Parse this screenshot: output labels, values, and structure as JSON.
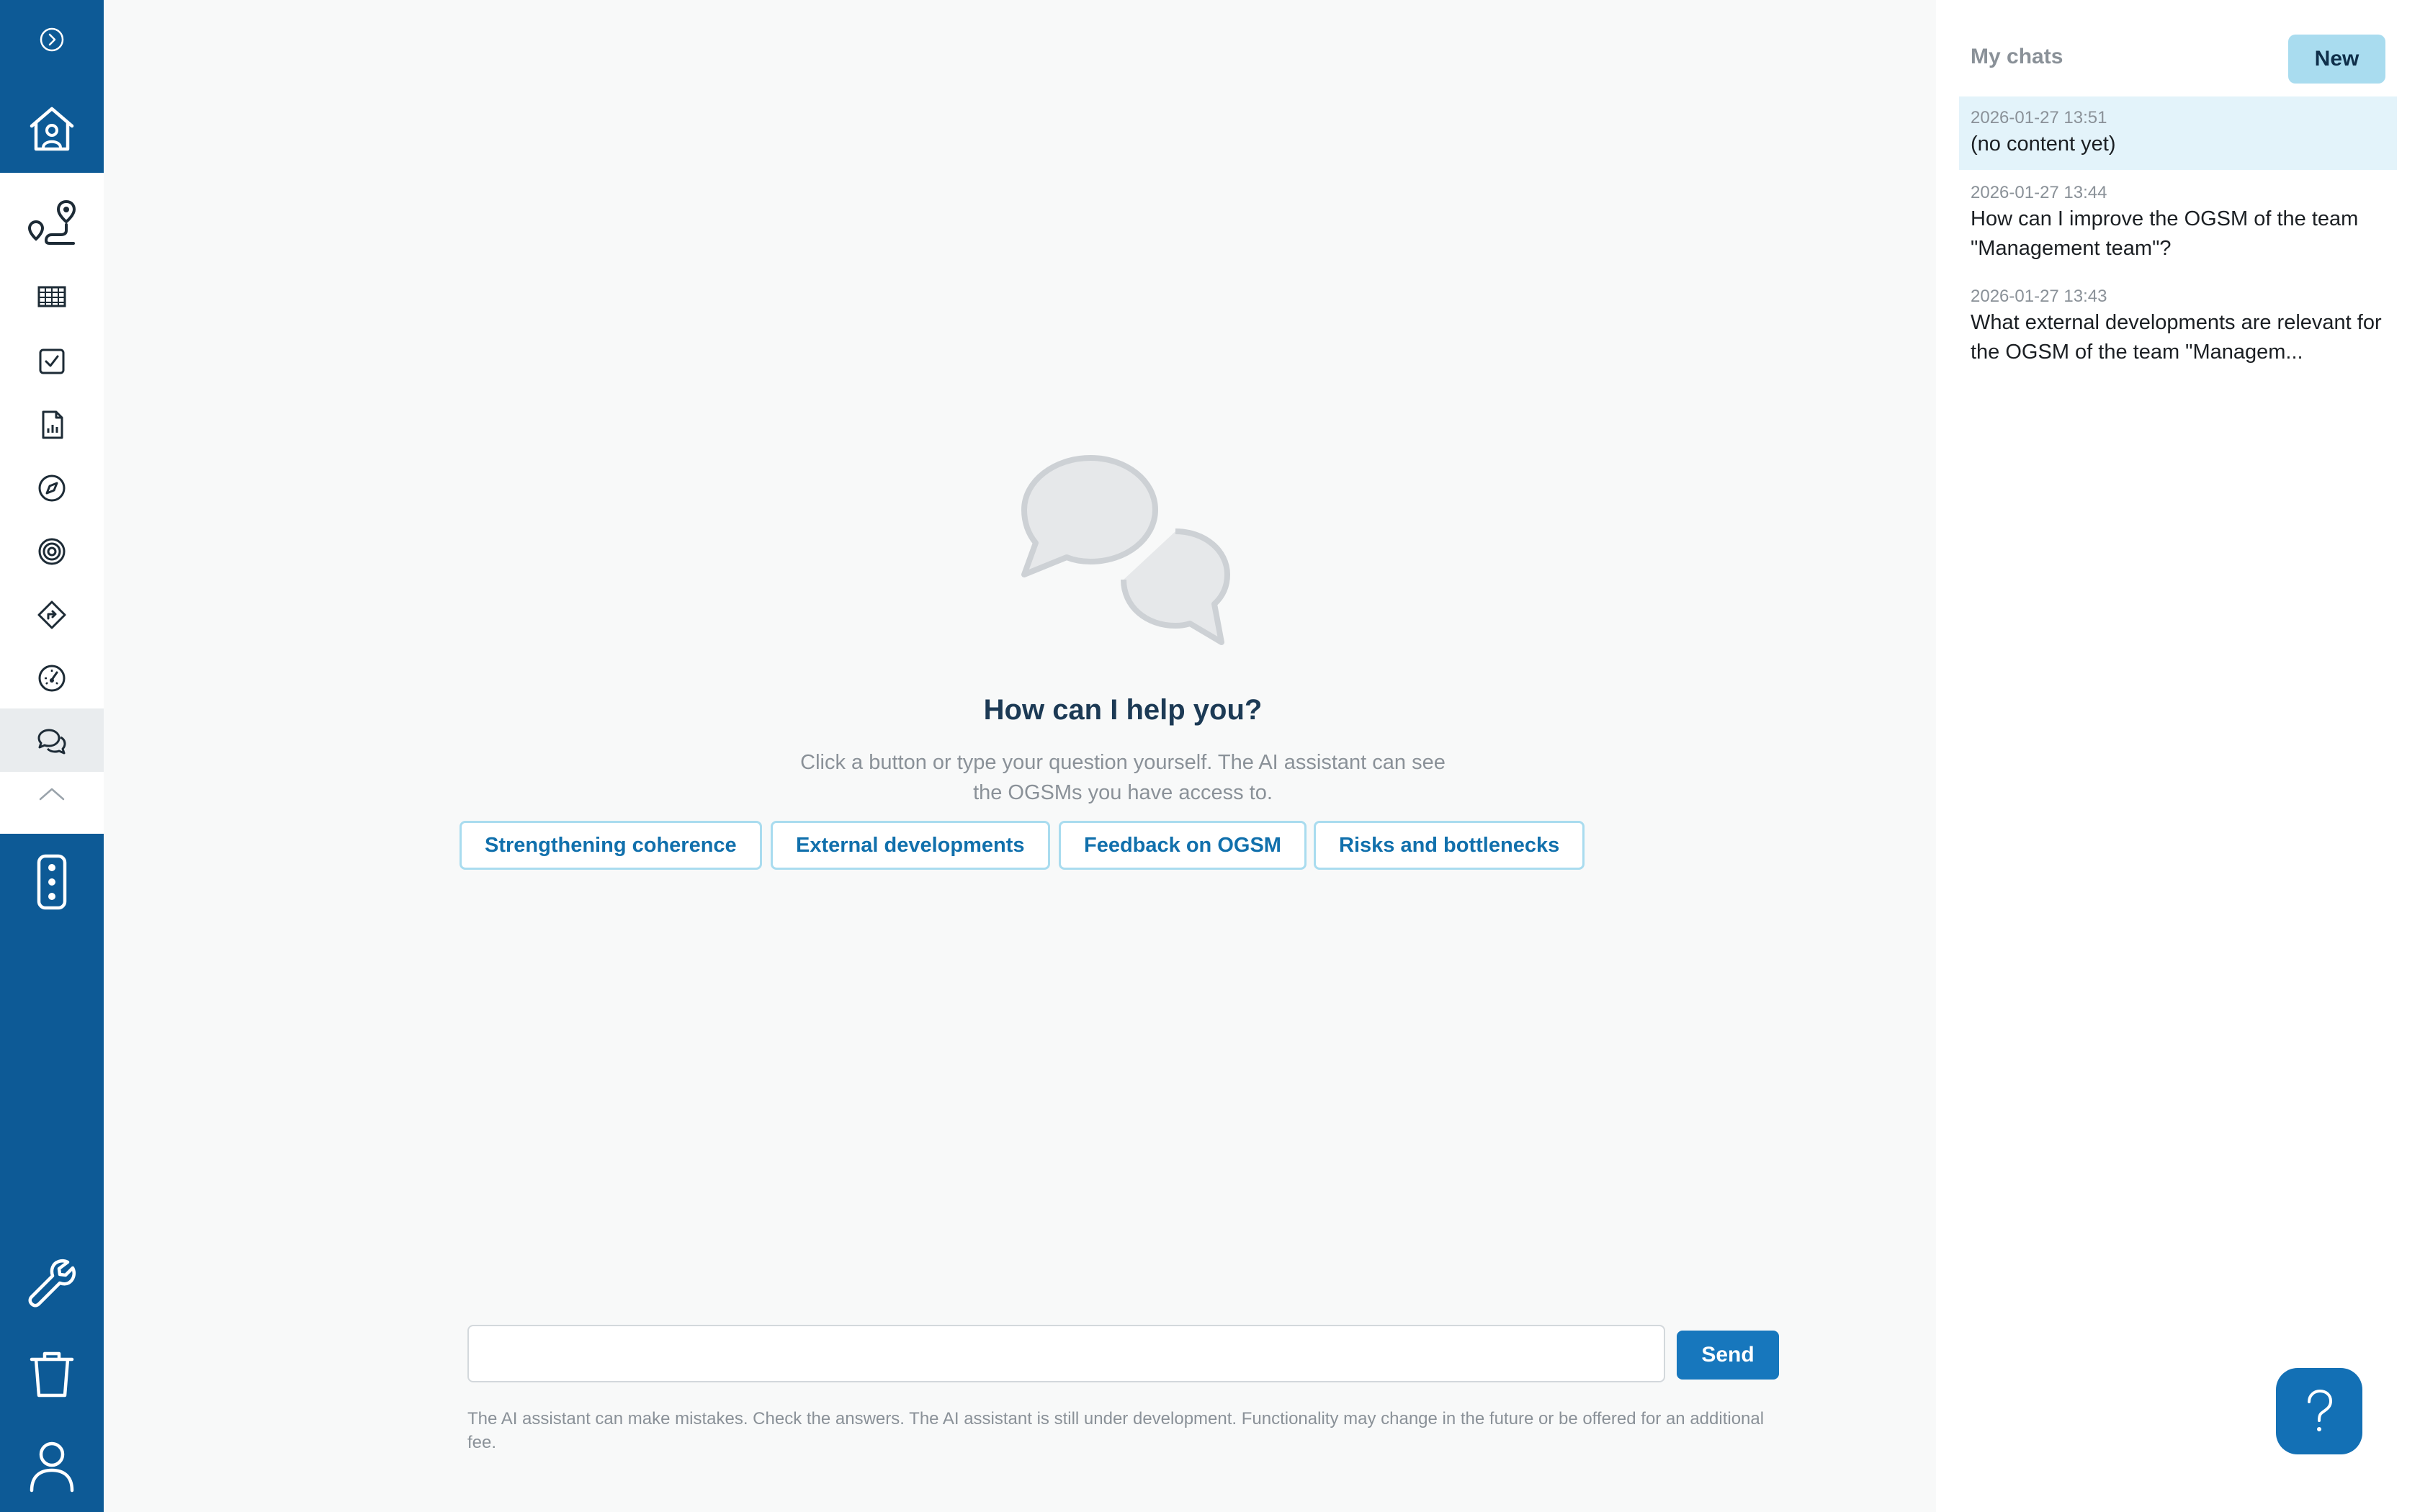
{
  "main": {
    "heading": "How can I help you?",
    "subtext": "Click a button or type your question yourself. The AI assistant can see the OGSMs you have access to.",
    "suggestions": [
      {
        "label": "Strengthening coherence"
      },
      {
        "label": "External developments"
      },
      {
        "label": "Feedback on OGSM"
      },
      {
        "label": "Risks and bottlenecks"
      }
    ],
    "input": {
      "value": "",
      "placeholder": ""
    },
    "send_label": "Send",
    "disclaimer": "The AI assistant can make mistakes. Check the answers. The AI assistant is still under development. Functionality may change in the future or be offered for an additional fee."
  },
  "chats_panel": {
    "title": "My chats",
    "new_label": "New",
    "items": [
      {
        "date": "2026-01-27 13:51",
        "text": "(no content yet)",
        "active": true
      },
      {
        "date": "2026-01-27 13:44",
        "text": "How can I improve the OGSM of the team \"Management team\"?"
      },
      {
        "date": "2026-01-27 13:43",
        "text": "What external developments are relevant for the OGSM of the team \"Managem..."
      }
    ]
  },
  "sidebar": {
    "icons": [
      "expand-icon",
      "home-icon",
      "route-icon",
      "table-icon",
      "checkbox-icon",
      "report-icon",
      "compass-icon",
      "target-icon",
      "direction-sign-icon",
      "dashboard-icon",
      "chat-icon",
      "chevron-up-icon",
      "traffic-light-icon",
      "wrench-icon",
      "trash-icon",
      "user-icon"
    ],
    "active_item": "chat"
  },
  "colors": {
    "sidebar_bg": "#0d5a96",
    "accent": "#1777bd",
    "suggestion_border": "#a9dcef",
    "active_chat_bg": "#e3f3fa",
    "heading": "#1c3a55"
  }
}
